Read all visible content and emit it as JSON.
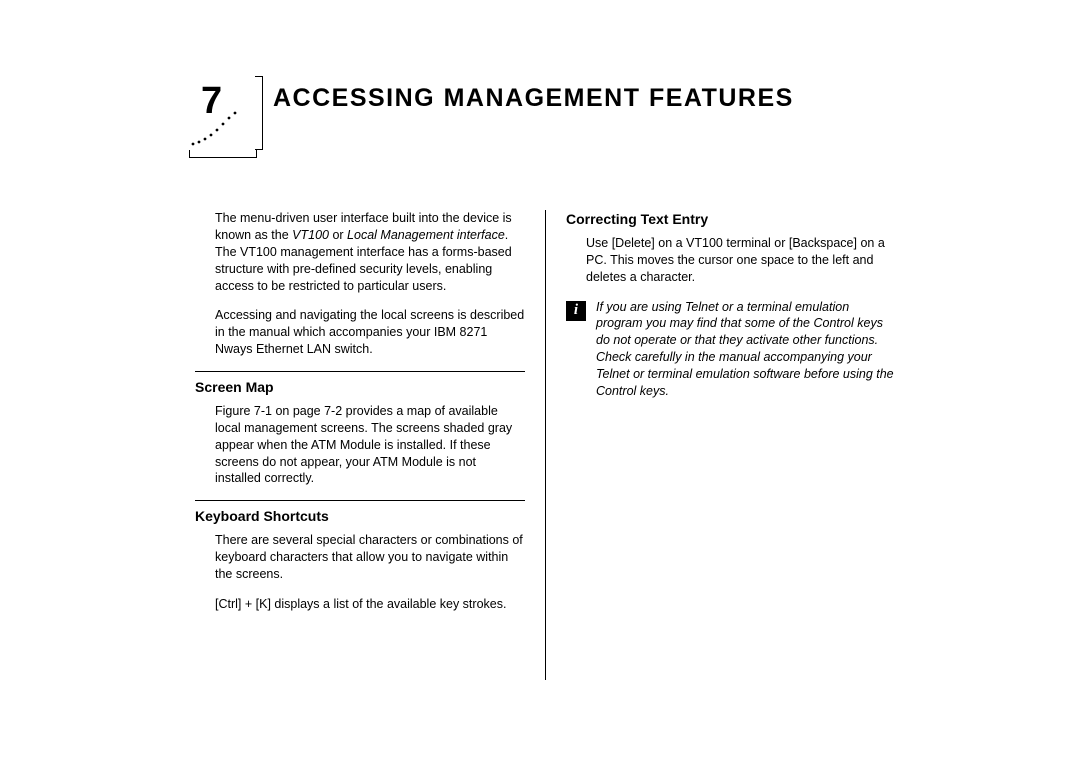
{
  "chapter": {
    "number": "7",
    "title": "ACCESSING MANAGEMENT FEATURES"
  },
  "left_column": {
    "intro_p1_a": "The menu-driven user interface built into the device is known as the ",
    "intro_p1_italic": "VT100",
    "intro_p1_b": " or ",
    "intro_p1_italic2": "Local Management interface",
    "intro_p1_c": ". The VT100 management interface has a forms-based structure with pre-defined security levels, enabling access to be restricted to particular users.",
    "intro_p2": "Accessing and navigating the local screens is described in the manual which accompanies your IBM 8271 Nways Ethernet LAN switch.",
    "screen_map": {
      "heading": "Screen Map",
      "body": "Figure 7-1 on page 7-2 provides a map of available local management screens. The screens shaded gray appear when the ATM Module is installed. If these screens do not appear, your ATM Module is not installed correctly."
    },
    "keyboard_shortcuts": {
      "heading": "Keyboard Shortcuts",
      "body1": "There are several special characters or combinations of keyboard characters that allow you to navigate within the screens.",
      "body2": "[Ctrl] + [K] displays a list of the available key strokes."
    }
  },
  "right_column": {
    "correcting": {
      "heading": "Correcting Text Entry",
      "body": "Use [Delete] on a VT100 terminal or [Backspace] on a PC. This moves the cursor one space to the left and deletes a character.",
      "note": "If you are using Telnet or a terminal emulation program you may find that some of the Control keys do not operate or that they activate other functions. Check carefully in the manual accompanying your Telnet or terminal emulation software before using the Control keys."
    }
  }
}
